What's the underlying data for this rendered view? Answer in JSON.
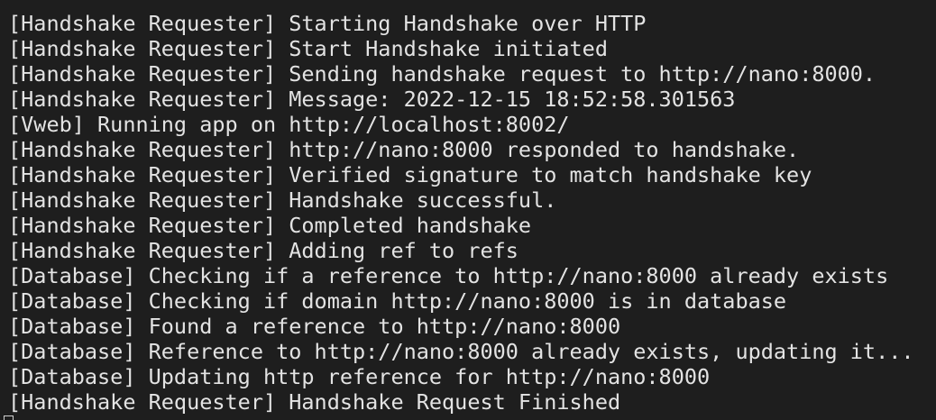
{
  "terminal": {
    "lines": [
      "[Handshake Requester] Starting Handshake over HTTP",
      "[Handshake Requester] Start Handshake initiated",
      "[Handshake Requester] Sending handshake request to http://nano:8000.",
      "[Handshake Requester] Message: 2022-12-15 18:52:58.301563",
      "[Vweb] Running app on http://localhost:8002/",
      "[Handshake Requester] http://nano:8000 responded to handshake.",
      "[Handshake Requester] Verified signature to match handshake key",
      "[Handshake Requester] Handshake successful.",
      "[Handshake Requester] Completed handshake",
      "[Handshake Requester] Adding ref to refs",
      "[Database] Checking if a reference to http://nano:8000 already exists",
      "[Database] Checking if domain http://nano:8000 is in database",
      "[Database] Found a reference to http://nano:8000",
      "[Database] Reference to http://nano:8000 already exists, updating it...",
      "[Database] Updating http reference for http://nano:8000",
      "[Handshake Requester] Handshake Request Finished"
    ]
  },
  "colors": {
    "background": "#1e1e1e",
    "text": "#e3e3e3"
  }
}
